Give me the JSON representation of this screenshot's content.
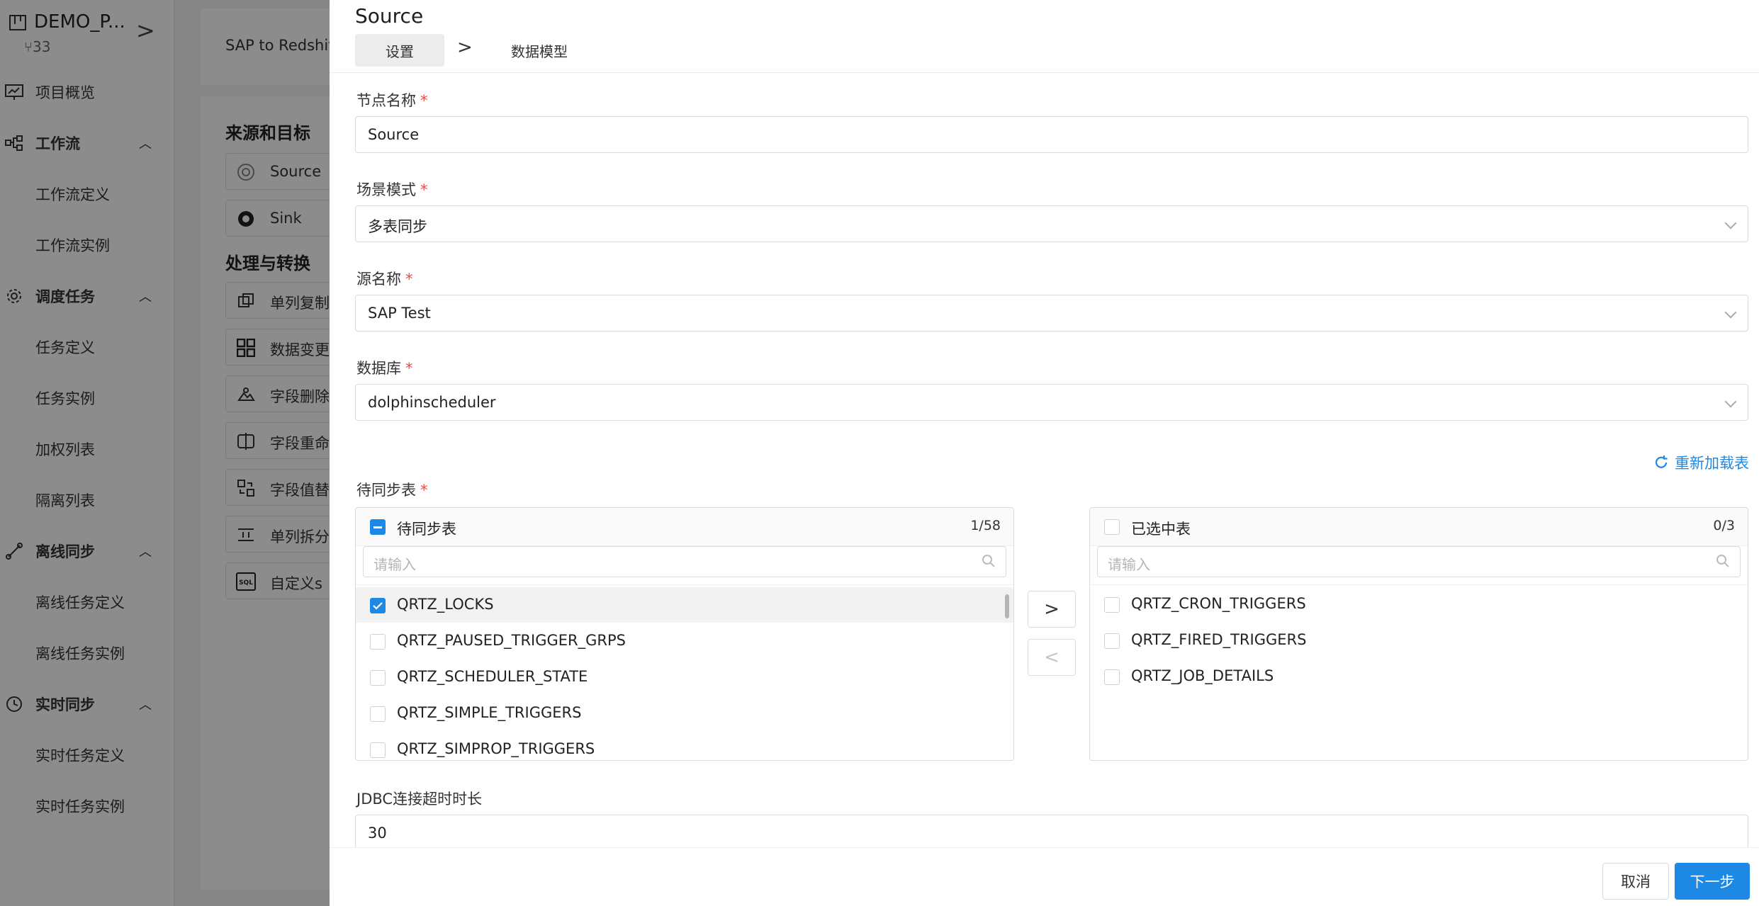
{
  "project": {
    "name": "DEMO_P...",
    "id_badge": "33",
    "chevron": ">"
  },
  "nav": {
    "overview": "项目概览",
    "workflow": "工作流",
    "workflow_def": "工作流定义",
    "workflow_inst": "工作流实例",
    "schedule": "调度任务",
    "task_def": "任务定义",
    "task_inst": "任务实例",
    "weighted_list": "加权列表",
    "isolation_list": "隔离列表",
    "offline_sync": "离线同步",
    "offline_def": "离线任务定义",
    "offline_inst": "离线任务实例",
    "realtime_sync": "实时同步",
    "realtime_def": "实时任务定义",
    "realtime_inst": "实时任务实例"
  },
  "background": {
    "breadcrumb": "SAP to Redshif",
    "section_source_target": "来源和目标",
    "source_item": "Source",
    "sink_item": "Sink",
    "section_transform": "处理与转换",
    "palette": [
      "单列复制",
      "数据变更",
      "字段删除",
      "字段重命",
      "字段值替",
      "单列拆分",
      "自定义s"
    ]
  },
  "drawer": {
    "title": "Source",
    "steps": {
      "settings": "设置",
      "separator": ">",
      "model": "数据模型"
    },
    "fields": {
      "node_name": {
        "label": "节点名称",
        "value": "Source"
      },
      "scene_mode": {
        "label": "场景模式",
        "value": "多表同步"
      },
      "source_name": {
        "label": "源名称",
        "value": "SAP Test"
      },
      "database": {
        "label": "数据库",
        "value": "dolphinscheduler"
      },
      "tables": {
        "label": "待同步表"
      },
      "jdbc_timeout": {
        "label": "JDBC连接超时时长",
        "value": "30"
      }
    },
    "required_mark": "*",
    "reload_label": "重新加载表",
    "left_panel": {
      "title": "待同步表",
      "count": "1/58",
      "placeholder": "请输入",
      "rows": [
        "QRTZ_LOCKS",
        "QRTZ_PAUSED_TRIGGER_GRPS",
        "QRTZ_SCHEDULER_STATE",
        "QRTZ_SIMPLE_TRIGGERS",
        "QRTZ_SIMPROP_TRIGGERS"
      ]
    },
    "right_panel": {
      "title": "已选中表",
      "count": "0/3",
      "placeholder": "请输入",
      "rows": [
        "QRTZ_CRON_TRIGGERS",
        "QRTZ_FIRED_TRIGGERS",
        "QRTZ_JOB_DETAILS"
      ]
    },
    "transfer": {
      "to_right": ">",
      "to_left": "<"
    },
    "footer": {
      "cancel": "取消",
      "next": "下一步"
    }
  },
  "colors": {
    "primary": "#1e88e5",
    "required": "#e74c3c",
    "mask": "rgba(0,0,0,0.45)"
  }
}
